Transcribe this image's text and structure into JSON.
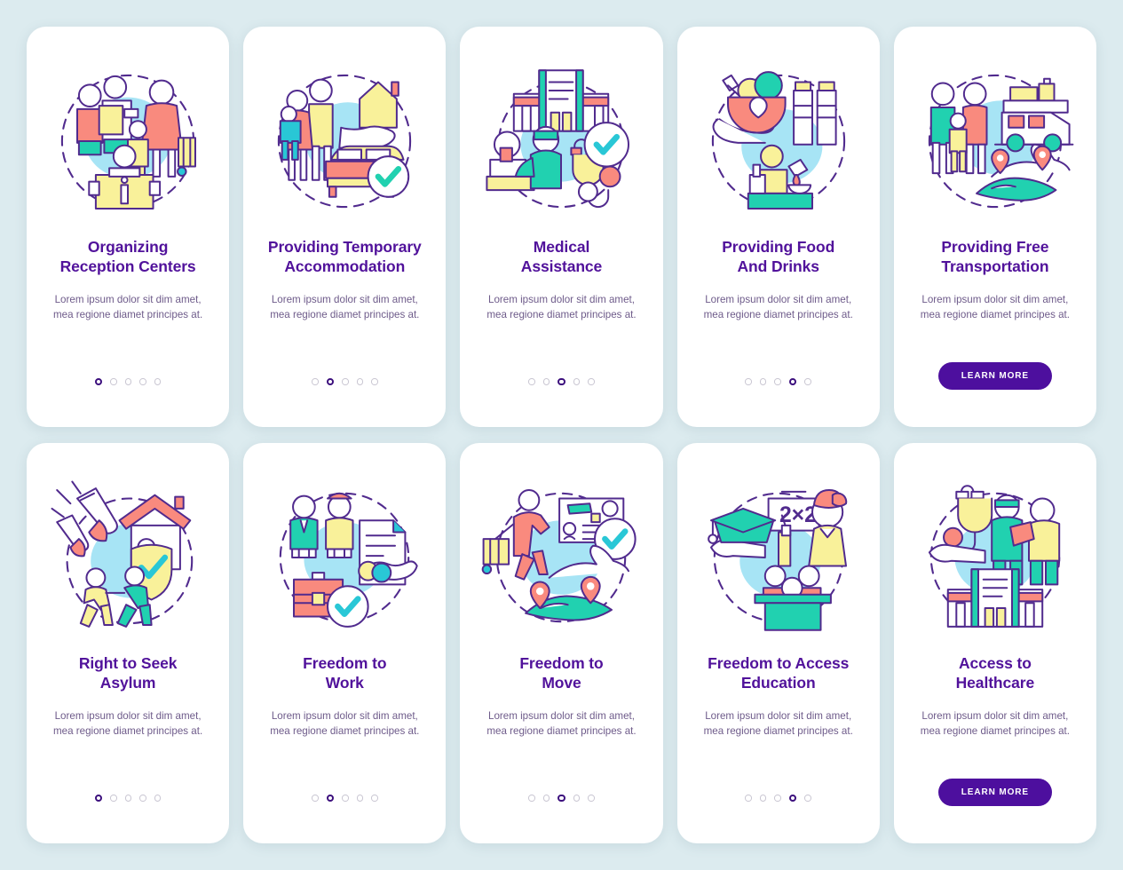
{
  "page": {
    "background_color": "#dcebef",
    "card_background": "#ffffff",
    "title_color": "#51129b",
    "body_color": "#6e5b8a",
    "accent_color": "#4d0f9e",
    "dot_inactive_color": "#c9c6d2",
    "columns": 5,
    "rows": 2,
    "total_screens": 10
  },
  "shared": {
    "body_text": "Lorem ipsum dolor sit dim amet, mea regione diamet principes at.",
    "learn_more_label": "LEARN MORE"
  },
  "screens": [
    {
      "title": "Organizing\nReception Centers",
      "body": "Lorem ipsum dolor sit dim amet, mea regione diamet principes at.",
      "dots_total": 5,
      "dots_active": 1,
      "has_button": false,
      "icon": "reception-center-icon"
    },
    {
      "title": "Providing Temporary\nAccommodation",
      "body": "Lorem ipsum dolor sit dim amet, mea regione diamet principes at.",
      "dots_total": 5,
      "dots_active": 2,
      "has_button": false,
      "icon": "temporary-accommodation-icon"
    },
    {
      "title": "Medical\nAssistance",
      "body": "Lorem ipsum dolor sit dim amet, mea regione diamet principes at.",
      "dots_total": 5,
      "dots_active": 3,
      "has_button": false,
      "icon": "medical-assistance-icon"
    },
    {
      "title": "Providing Food\nAnd Drinks",
      "body": "Lorem ipsum dolor sit dim amet, mea regione diamet principes at.",
      "dots_total": 5,
      "dots_active": 4,
      "has_button": false,
      "icon": "food-and-drinks-icon"
    },
    {
      "title": "Providing Free\nTransportation",
      "body": "Lorem ipsum dolor sit dim amet, mea regione diamet principes at.",
      "dots_total": 0,
      "dots_active": 0,
      "has_button": true,
      "button_label": "LEARN MORE",
      "icon": "free-transportation-icon"
    },
    {
      "title": "Right to Seek\nAsylum",
      "body": "Lorem ipsum dolor sit dim amet, mea regione diamet principes at.",
      "dots_total": 5,
      "dots_active": 1,
      "has_button": false,
      "icon": "right-to-seek-asylum-icon"
    },
    {
      "title": "Freedom to\nWork",
      "body": "Lorem ipsum dolor sit dim amet, mea regione diamet principes at.",
      "dots_total": 5,
      "dots_active": 2,
      "has_button": false,
      "icon": "freedom-to-work-icon"
    },
    {
      "title": "Freedom to\nMove",
      "body": "Lorem ipsum dolor sit dim amet, mea regione diamet principes at.",
      "dots_total": 5,
      "dots_active": 3,
      "has_button": false,
      "icon": "freedom-to-move-icon"
    },
    {
      "title": "Freedom to Access\nEducation",
      "body": "Lorem ipsum dolor sit dim amet, mea regione diamet principes at.",
      "dots_total": 5,
      "dots_active": 4,
      "has_button": false,
      "icon": "freedom-to-access-education-icon"
    },
    {
      "title": "Access to\nHealthcare",
      "body": "Lorem ipsum dolor sit dim amet, mea regione diamet principes at.",
      "dots_total": 0,
      "dots_active": 0,
      "has_button": true,
      "button_label": "LEARN MORE",
      "icon": "access-to-healthcare-icon"
    }
  ]
}
